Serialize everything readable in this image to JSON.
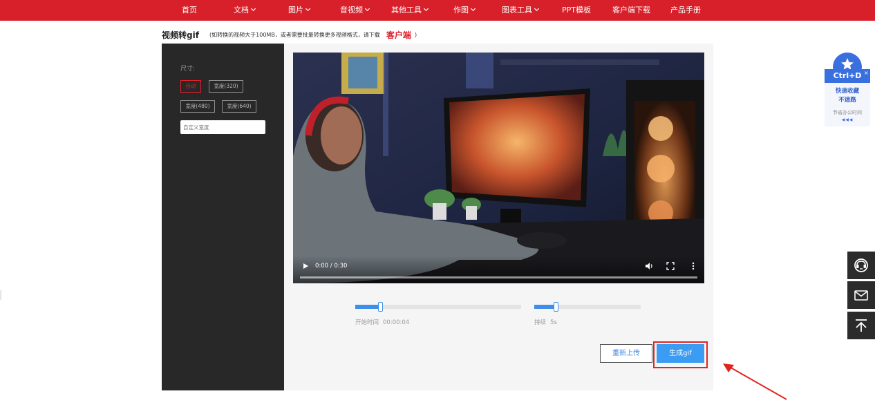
{
  "nav": {
    "items": [
      {
        "label": "首页",
        "dropdown": false
      },
      {
        "label": "文档",
        "dropdown": true
      },
      {
        "label": "图片",
        "dropdown": true
      },
      {
        "label": "音视频",
        "dropdown": true
      },
      {
        "label": "其他工具",
        "dropdown": true
      },
      {
        "label": "作图",
        "dropdown": true
      },
      {
        "label": "图表工具",
        "dropdown": true
      },
      {
        "label": "PPT模板",
        "dropdown": false
      },
      {
        "label": "客户端下载",
        "dropdown": false
      },
      {
        "label": "产品手册",
        "dropdown": false
      }
    ],
    "bg_color": "#d8202a"
  },
  "page": {
    "title": "视频转gif",
    "note": "(如转换的视频大于100MB，或者需要批量转换更多视频格式，请下载",
    "client_link": "客户端",
    "note_close": ")"
  },
  "settings": {
    "size_label": "尺寸:",
    "options": [
      {
        "label": "自动",
        "active": true
      },
      {
        "label": "宽度(320)",
        "active": false
      },
      {
        "label": "宽度(480)",
        "active": false
      },
      {
        "label": "宽度(640)",
        "active": false
      }
    ],
    "custom_width_placeholder": "自定义宽度"
  },
  "video": {
    "timecode": "0:00 / 0:30",
    "progress": 0
  },
  "start_slider": {
    "label": "开始时间",
    "value": "00:00:04",
    "fraction": 0.15
  },
  "duration_slider": {
    "label": "持续",
    "value": "5s",
    "fraction": 0.2
  },
  "buttons": {
    "reupload": "重新上传",
    "generate": "生成gif"
  },
  "bookmark": {
    "hotkey": "Ctrl+D",
    "line1": "快速收藏",
    "line2": "不迷路",
    "sub": "节省办公时间",
    "close": "×",
    "dots": "◀◀◀"
  },
  "colors": {
    "accent_red": "#e01f2a",
    "primary_blue": "#3a9cf3",
    "panel_dark": "#282828"
  },
  "icons": {
    "side_buttons": [
      "headset-icon",
      "mail-icon",
      "back-to-top-icon"
    ]
  }
}
